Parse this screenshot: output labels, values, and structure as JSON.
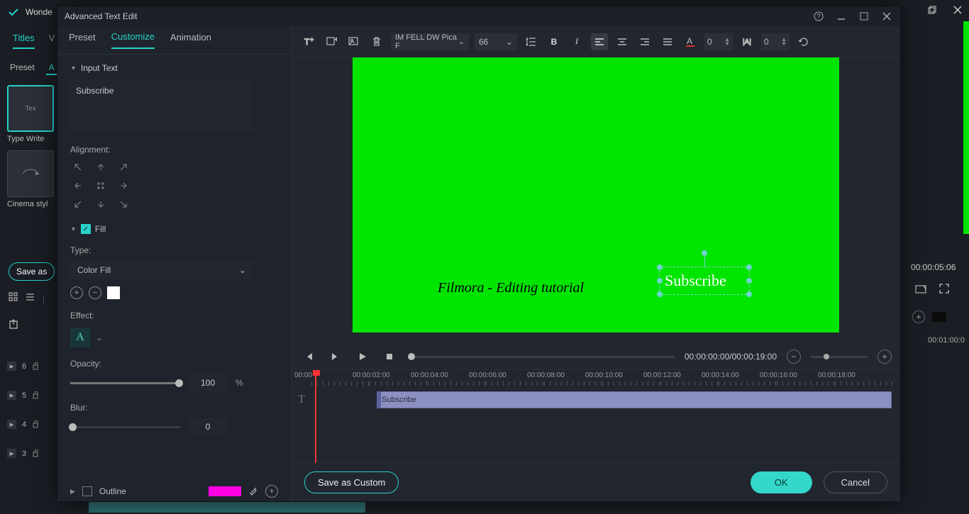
{
  "app": {
    "name": "Wonde"
  },
  "mainTabs": [
    "Titles",
    "V"
  ],
  "subTabs": [
    "Preset",
    "A"
  ],
  "thumbs": [
    {
      "label": "Tex",
      "caption": "Type Write"
    },
    {
      "label": "",
      "caption": "Cinema styl"
    }
  ],
  "saveAs": "Save as",
  "tracks": [
    "6",
    "5",
    "4",
    "3"
  ],
  "modal": {
    "title": "Advanced Text Edit",
    "tabs": [
      "Preset",
      "Customize",
      "Animation"
    ],
    "activeTab": "Customize",
    "inputText": {
      "header": "Input Text",
      "value": "Subscribe"
    },
    "alignmentLabel": "Alignment:",
    "fill": {
      "label": "Fill",
      "checked": true,
      "typeLabel": "Type:",
      "typeValue": "Color Fill"
    },
    "effectLabel": "Effect:",
    "opacity": {
      "label": "Opacity:",
      "value": "100",
      "unit": "%"
    },
    "blur": {
      "label": "Blur:",
      "value": "0"
    },
    "outline": {
      "label": "Outline"
    },
    "toolbar": {
      "font": "IM FELL DW Pica F",
      "size": "66",
      "spin1": "0",
      "spin2": "0"
    },
    "canvas": {
      "text1": "Filmora - Editing tutorial",
      "selText": "Subscribe"
    },
    "playbar": {
      "time": "00:00:00:00/00:00:19:00"
    },
    "timelineTicks": [
      "00:00",
      "00:00:02:00",
      "00:00:04:00",
      "00:00:06:00",
      "00:00:08:00",
      "00:00:10:00",
      "00:00:12:00",
      "00:00:14:00",
      "00:00:16:00",
      "00:00:18:00"
    ],
    "clipLabel": "Subscribe",
    "footer": {
      "save": "Save as Custom",
      "ok": "OK",
      "cancel": "Cancel"
    }
  },
  "right": {
    "tc": "00:00:05:06",
    "tcr": "00:01:00:0"
  }
}
